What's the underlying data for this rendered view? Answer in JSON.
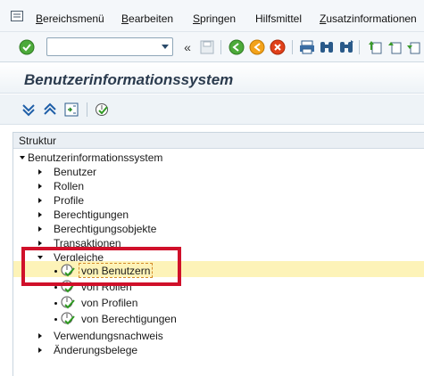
{
  "menu": {
    "items": [
      {
        "u": "B",
        "rest": "ereichsmenü"
      },
      {
        "u": "B",
        "rest": "earbeiten"
      },
      {
        "u": "S",
        "rest": "pringen"
      },
      {
        "u": "",
        "rest": "Hilfsmittel",
        "uidx": "f"
      },
      {
        "u": "Z",
        "rest": "usatzinformationen"
      }
    ],
    "menu_icon": "menu-icon"
  },
  "toolbar": {
    "command_value": "",
    "buttons": [
      "confirm-icon",
      "save-icon",
      "back-icon",
      "exit-icon",
      "cancel-icon",
      "print-icon",
      "find-icon",
      "find-next-icon",
      "first-page-icon",
      "previous-page-icon",
      "next-page-icon"
    ]
  },
  "title": "Benutzerinformationssystem",
  "apptoolbar": {
    "buttons": [
      "expand-all-icon",
      "collapse-all-icon",
      "select-icon",
      "execute-icon"
    ]
  },
  "tree": {
    "header": "Struktur",
    "root": "Benutzerinformationssystem",
    "children": [
      "Benutzer",
      "Rollen",
      "Profile",
      "Berechtigungen",
      "Berechtigungsobjekte",
      "Transaktionen"
    ],
    "vergleiche": {
      "label": "Vergleiche",
      "children": [
        "von Benutzern",
        "von Rollen",
        "von Profilen",
        "von Berechtigungen"
      ]
    },
    "after": [
      "Verwendungsnachweis",
      "Änderungsbelege"
    ]
  },
  "colors": {
    "highlight": "#fdf3b8",
    "annotation_box": "#d0102a",
    "title_color": "#2b3b4e"
  }
}
